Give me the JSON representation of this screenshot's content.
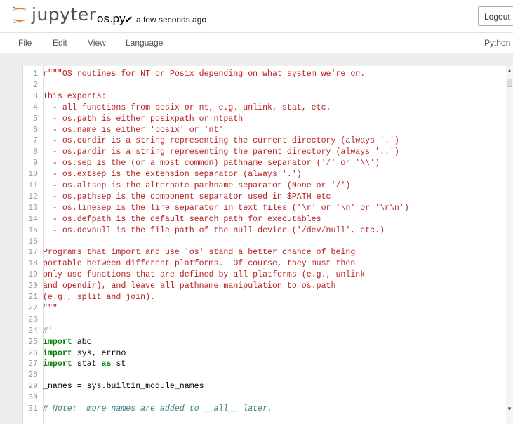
{
  "header": {
    "logo_text": "jupyter",
    "filename": "os.py",
    "save_check": "✔",
    "save_status": "a few seconds ago",
    "logout_label": "Logout"
  },
  "menubar": {
    "items": [
      "File",
      "Edit",
      "View",
      "Language"
    ],
    "language_indicator": "Python"
  },
  "colors": {
    "logo_orange": "#f37626",
    "string": "#ba2121",
    "keyword": "#008000",
    "comment": "#408080",
    "line_number": "#999999"
  },
  "editor": {
    "lines": [
      {
        "n": "1",
        "t": "str",
        "code": "r\"\"\"OS routines for NT or Posix depending on what system we're on."
      },
      {
        "n": "2",
        "t": "str",
        "code": ""
      },
      {
        "n": "3",
        "t": "str",
        "code": "This exports:"
      },
      {
        "n": "4",
        "t": "str",
        "code": "  - all functions from posix or nt, e.g. unlink, stat, etc."
      },
      {
        "n": "5",
        "t": "str",
        "code": "  - os.path is either posixpath or ntpath"
      },
      {
        "n": "6",
        "t": "str",
        "code": "  - os.name is either 'posix' or 'nt'"
      },
      {
        "n": "7",
        "t": "str",
        "code": "  - os.curdir is a string representing the current directory (always '.')"
      },
      {
        "n": "8",
        "t": "str",
        "code": "  - os.pardir is a string representing the parent directory (always '..')"
      },
      {
        "n": "9",
        "t": "str",
        "code": "  - os.sep is the (or a most common) pathname separator ('/' or '\\\\')"
      },
      {
        "n": "10",
        "t": "str",
        "code": "  - os.extsep is the extension separator (always '.')"
      },
      {
        "n": "11",
        "t": "str",
        "code": "  - os.altsep is the alternate pathname separator (None or '/')"
      },
      {
        "n": "12",
        "t": "str",
        "code": "  - os.pathsep is the component separator used in $PATH etc"
      },
      {
        "n": "13",
        "t": "str",
        "code": "  - os.linesep is the line separator in text files ('\\r' or '\\n' or '\\r\\n')"
      },
      {
        "n": "14",
        "t": "str",
        "code": "  - os.defpath is the default search path for executables"
      },
      {
        "n": "15",
        "t": "str",
        "code": "  - os.devnull is the file path of the null device ('/dev/null', etc.)"
      },
      {
        "n": "16",
        "t": "str",
        "code": ""
      },
      {
        "n": "17",
        "t": "str",
        "code": "Programs that import and use 'os' stand a better chance of being"
      },
      {
        "n": "18",
        "t": "str",
        "code": "portable between different platforms.  Of course, they must then"
      },
      {
        "n": "19",
        "t": "str",
        "code": "only use functions that are defined by all platforms (e.g., unlink"
      },
      {
        "n": "20",
        "t": "str",
        "code": "and opendir), and leave all pathname manipulation to os.path"
      },
      {
        "n": "21",
        "t": "str",
        "code": "(e.g., split and join)."
      },
      {
        "n": "22",
        "t": "str",
        "code": "\"\"\""
      },
      {
        "n": "23",
        "t": "plain",
        "code": ""
      },
      {
        "n": "24",
        "t": "cmt",
        "code": "#'"
      },
      {
        "n": "25",
        "t": "kw1",
        "kw": "import",
        "rest": " abc"
      },
      {
        "n": "26",
        "t": "kw1",
        "kw": "import",
        "rest": " sys, errno"
      },
      {
        "n": "27",
        "t": "kw2",
        "kw": "import",
        "mid": " stat ",
        "kw2": "as",
        "rest": " st"
      },
      {
        "n": "28",
        "t": "plain",
        "code": ""
      },
      {
        "n": "29",
        "t": "plain",
        "code": "_names = sys.builtin_module_names"
      },
      {
        "n": "30",
        "t": "plain",
        "code": ""
      },
      {
        "n": "31",
        "t": "cmt",
        "code": "# Note:  more names are added to __all__ later."
      }
    ]
  }
}
